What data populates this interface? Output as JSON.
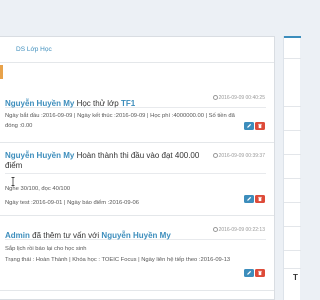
{
  "panel": {
    "header_link": "DS Lớp Học"
  },
  "feed": [
    {
      "who": "Nguyễn Huyền My",
      "action": " Học thử lớp ",
      "target": "TF1",
      "time": "2016-09-09 00:40:25",
      "lines": [
        "Ngày bắt đầu :2016-09-09 | Ngày kết thúc :2016-09-09 | Học phí :4000000.00 | Số tiền đã",
        "đóng :0.00"
      ]
    },
    {
      "who": "Nguyễn Huyền My",
      "action": " Hoàn thành thi đầu vào đạt 400.00",
      "action2": "điểm",
      "time": "2016-09-09 00:39:37",
      "lines": [
        "Nghe 30/100, đọc 40/100",
        "Ngày test :2016-09-01 | Ngày báo điểm :2016-09-06"
      ]
    },
    {
      "who": "Admin",
      "action": " đã thêm tư vấn với ",
      "target": "Nguyễn Huyền My",
      "time": "2016-09-09 00:22:13",
      "lines": [
        "Sắp lịch rồi báo lại cho học sinh",
        "Trạng thái : Hoàn Thành | Khóa học : TOEIC Focus | Ngày liên hệ tiếp theo :2016-09-13"
      ]
    }
  ],
  "right_panel": {
    "title_initial": "T"
  },
  "icons": {
    "time": "clock-icon",
    "edit": "pencil-icon",
    "delete": "trash-icon"
  },
  "colors": {
    "link": "#3c8dbc",
    "edit": "#3c8dbc",
    "delete": "#dd4b39",
    "accent": "#e8a24a"
  }
}
